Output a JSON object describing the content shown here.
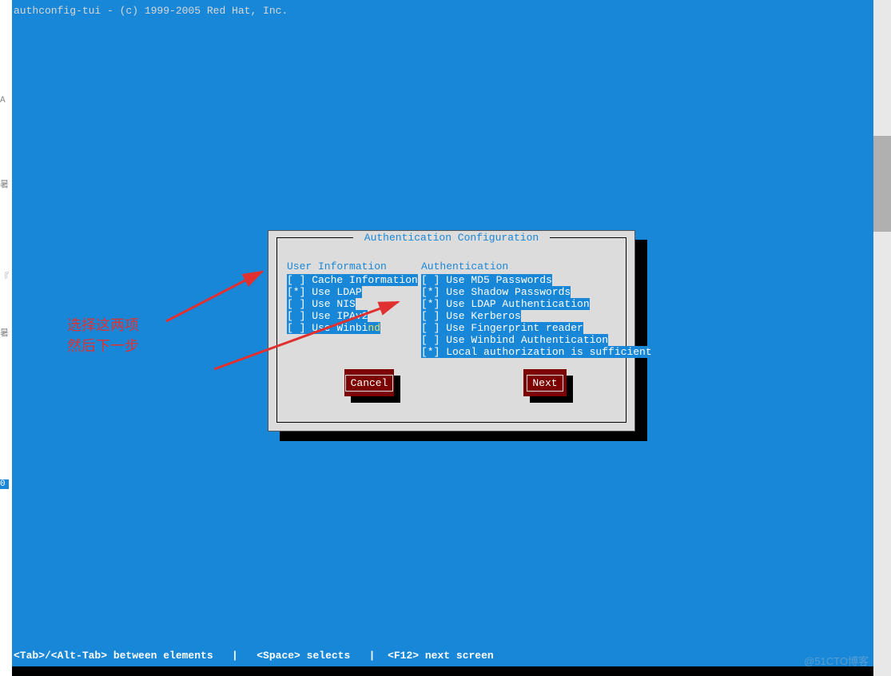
{
  "header": {
    "title": "authconfig-tui - (c) 1999-2005 Red Hat, Inc."
  },
  "dialog": {
    "title": " Authentication Configuration ",
    "user_info_header": "User Information",
    "auth_header": "Authentication",
    "user_options": [
      {
        "checked": false,
        "label": "Cache Information"
      },
      {
        "checked": true,
        "label": "Use LDAP"
      },
      {
        "checked": false,
        "label": "Use NIS"
      },
      {
        "checked": false,
        "label": "Use IPAv2"
      },
      {
        "checked": false,
        "label": "Use Winbind"
      }
    ],
    "auth_options": [
      {
        "checked": false,
        "label": "Use MD5 Passwords"
      },
      {
        "checked": true,
        "label": "Use Shadow Passwords"
      },
      {
        "checked": true,
        "label": "Use LDAP Authentication"
      },
      {
        "checked": false,
        "label": "Use Kerberos"
      },
      {
        "checked": false,
        "label": "Use Fingerprint reader"
      },
      {
        "checked": false,
        "label": "Use Winbind Authentication"
      },
      {
        "checked": true,
        "label": "Local authorization is sufficient"
      }
    ],
    "cancel_label": "Cancel",
    "next_label": "Next"
  },
  "footer": {
    "hint": "<Tab>/<Alt-Tab> between elements   |   <Space> selects   |  <F12> next screen"
  },
  "annotation": {
    "line1": "选择这两项",
    "line2": "然后下一步"
  },
  "watermark": "@51CTO博客"
}
